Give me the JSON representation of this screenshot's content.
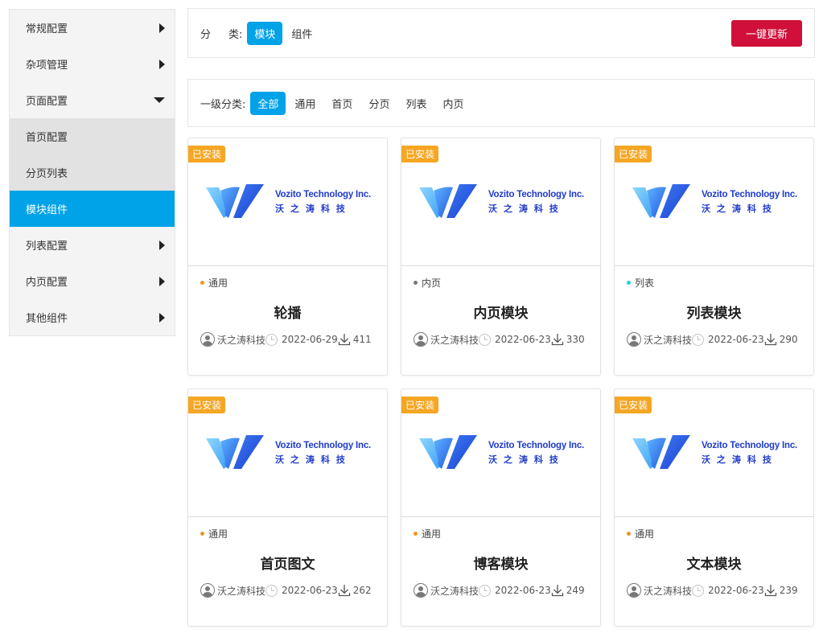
{
  "sidebar": {
    "items": [
      {
        "label": "常规配置"
      },
      {
        "label": "杂项管理"
      },
      {
        "label": "页面配置"
      },
      {
        "label": "首页配置"
      },
      {
        "label": "分页列表"
      },
      {
        "label": "模块组件"
      },
      {
        "label": "列表配置"
      },
      {
        "label": "内页配置"
      },
      {
        "label": "其他组件"
      }
    ]
  },
  "filter": {
    "category_label_1": "分",
    "category_label_2": "类:",
    "categories": [
      "模块",
      "组件"
    ],
    "update_button": "一键更新",
    "level1_label": "一级分类:",
    "level1_options": [
      "全部",
      "通用",
      "首页",
      "分页",
      "列表",
      "内页"
    ]
  },
  "colors": {
    "accent": "#00a2e8",
    "update_button": "#d0103a",
    "installed_badge": "#f5a623",
    "tag_orange": "#f0941e",
    "tag_gray": "#777777",
    "tag_cyan": "#1fd0e6"
  },
  "logo": {
    "en": "Vozito Technology Inc.",
    "cn": "沃之涛科技"
  },
  "cards": [
    {
      "badge": "已安装",
      "tag": "通用",
      "title": "轮播",
      "author": "沃之涛科技",
      "date": "2022-06-29",
      "downloads": "411"
    },
    {
      "badge": "已安装",
      "tag": "内页",
      "title": "内页模块",
      "author": "沃之涛科技",
      "date": "2022-06-23",
      "downloads": "330"
    },
    {
      "badge": "已安装",
      "tag": "列表",
      "title": "列表模块",
      "author": "沃之涛科技",
      "date": "2022-06-23",
      "downloads": "290"
    },
    {
      "badge": "已安装",
      "tag": "通用",
      "title": "首页图文",
      "author": "沃之涛科技",
      "date": "2022-06-23",
      "downloads": "262"
    },
    {
      "badge": "已安装",
      "tag": "通用",
      "title": "博客模块",
      "author": "沃之涛科技",
      "date": "2022-06-23",
      "downloads": "249"
    },
    {
      "badge": "已安装",
      "tag": "通用",
      "title": "文本模块",
      "author": "沃之涛科技",
      "date": "2022-06-23",
      "downloads": "239"
    }
  ]
}
